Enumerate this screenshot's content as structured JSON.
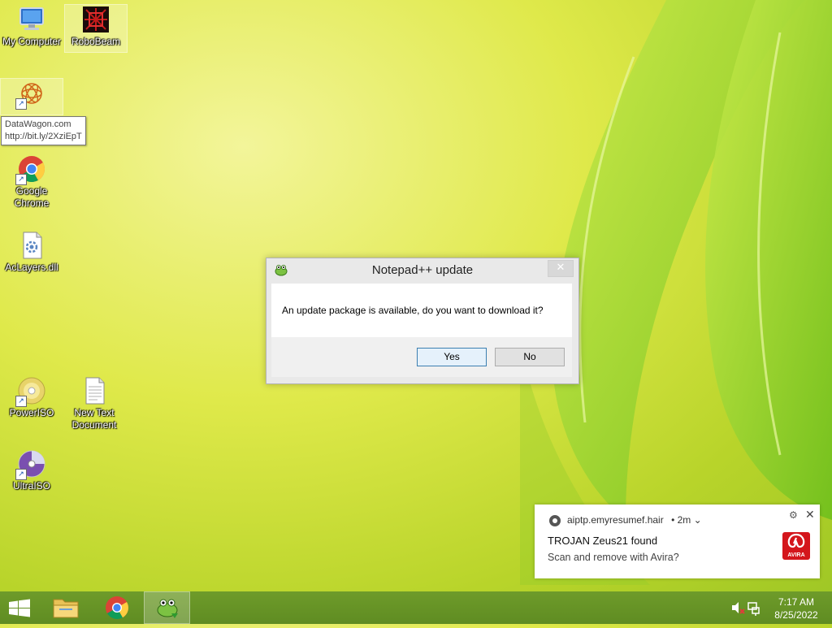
{
  "desktop": {
    "icons": [
      {
        "label": "My Computer",
        "icon": "computer-icon"
      },
      {
        "label": "RoboBeam",
        "icon": "robobeam-icon"
      },
      {
        "label": "",
        "icon": "datawagon-icon"
      },
      {
        "label": "Google Chrome",
        "icon": "chrome-icon"
      },
      {
        "label": "AcLayers.dll",
        "icon": "dll-file-icon"
      },
      {
        "label": "PowerISO",
        "icon": "poweriso-icon"
      },
      {
        "label": "New Text Document",
        "icon": "text-document-icon"
      },
      {
        "label": "UltraISO",
        "icon": "ultraiso-icon"
      }
    ],
    "tooltip": {
      "line1": "DataWagon.com",
      "line2": "http://bit.ly/2XziEpT"
    }
  },
  "dialog": {
    "title": "Notepad++ update",
    "message": "An update package is available, do you want to download it?",
    "yes_label": "Yes",
    "no_label": "No",
    "close_glyph": "✕"
  },
  "notification": {
    "source": "aiptp.emyresumef.hair",
    "time": "• 2m ⌄",
    "title": "TROJAN Zeus21 found",
    "body": "Scan and remove with Avira?",
    "brand_text": "AVIRA",
    "settings_glyph": "⚙",
    "close_glyph": "✕"
  },
  "taskbar": {
    "items": [
      "start-button",
      "file-explorer",
      "google-chrome",
      "notepad-plus-plus"
    ],
    "active_item": "notepad-plus-plus",
    "time": "7:17 AM",
    "date": "8/25/2022"
  },
  "colors": {
    "taskbar": "#6e9b2a",
    "avira_red": "#d4161c",
    "dialog_default_border": "#3c7fb1"
  }
}
